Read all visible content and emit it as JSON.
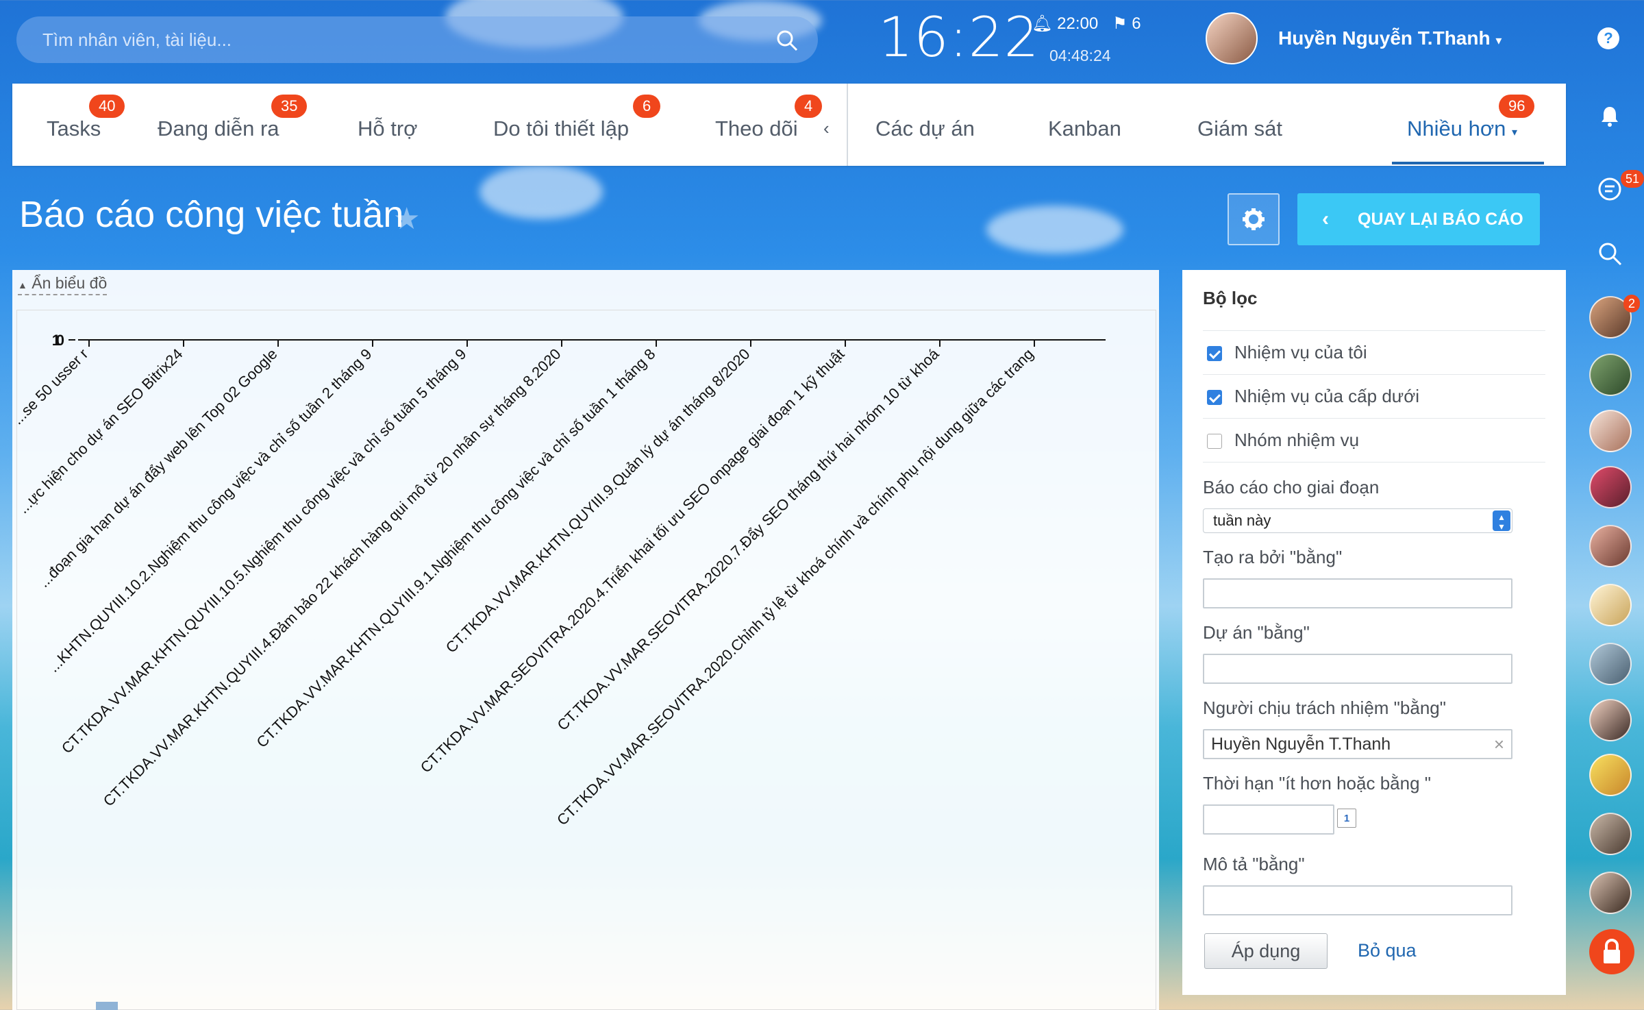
{
  "search": {
    "placeholder": "Tìm nhân viên, tài liệu..."
  },
  "header": {
    "clock": "16:22",
    "alarm": "22:00",
    "flag_count": "6",
    "timer": "04:48:24",
    "user_name": "Huyền Nguyễn T.Thanh",
    "help": "?"
  },
  "tabs": [
    {
      "label": "Tasks",
      "badge": "40"
    },
    {
      "label": "Đang diễn ra",
      "badge": "35"
    },
    {
      "label": "Hỗ trợ",
      "badge": ""
    },
    {
      "label": "Do tôi thiết lập",
      "badge": "6"
    },
    {
      "label": "Theo dõi",
      "badge": "4"
    },
    {
      "label": "Các dự án",
      "badge": ""
    },
    {
      "label": "Kanban",
      "badge": ""
    },
    {
      "label": "Giám sát",
      "badge": ""
    },
    {
      "label": "Nhiều hơn",
      "badge": "96"
    }
  ],
  "page": {
    "title": "Báo cáo công việc tuần",
    "back_button": "QUAY LẠI BÁO CÁO",
    "hide_chart": "Ẩn biểu đồ"
  },
  "chart_data": {
    "type": "bar",
    "ytick_labels": [
      "1",
      "0"
    ],
    "categories": [
      "...se 50 usser r",
      "...ực hiện cho dự án SEO Bitrix24",
      "...đoạn gia hạn dự án đẩy web lên Top 02 Google",
      "...KHTN.QUYIII.10.2.Nghiệm thu công việc và chỉ số tuần 2 tháng 9",
      "CT.TKDA.VV.MAR.KHTN.QUYIII.10.5.Nghiệm thu công việc và chỉ số tuần 5 tháng 9",
      "CT.TKDA.VV.MAR.KHTN.QUYIII.4.Đảm bảo 22 khách hàng qui mô  từ 20 nhân sự tháng 8.2020",
      "CT.TKDA.VV.MAR.KHTN.QUYIII.9.1.Nghiệm thu công việc và chỉ số tuần 1 tháng 8",
      "CT.TKDA.VV.MAR.KHTN.QUYIII.9.Quản lý dự án tháng 8/2020",
      "CT.TKDA.VV.MAR.SEOVITRA.2020.4.Triển khai tối ưu SEO onpage giai đoạn 1 kỹ thuật",
      "CT.TKDA.VV.MAR.SEOVITRA.2020.7.Đẩy SEO tháng thứ hai nhóm 10 từ khoá",
      "CT.TKDA.VV.MAR.SEOVITRA.2020.Chỉnh tỷ lệ từ khoá chính và chính phụ nội dung giữa các trang"
    ],
    "values": [
      0,
      0,
      0,
      0,
      0,
      0,
      0,
      0,
      0,
      0,
      0
    ],
    "legend_color": "#8fb3d6"
  },
  "filter": {
    "title": "Bộ lọc",
    "checks": [
      {
        "label": "Nhiệm vụ của tôi",
        "checked": true
      },
      {
        "label": "Nhiệm vụ của cấp dưới",
        "checked": true
      },
      {
        "label": "Nhóm nhiệm vụ",
        "checked": false
      }
    ],
    "period_label": "Báo cáo cho giai đoạn",
    "period_value": "tuần này",
    "created_by_label": "Tạo ra bởi \"bằng\"",
    "project_label": "Dự án \"bằng\"",
    "responsible_label": "Người chịu trách nhiệm \"bằng\"",
    "responsible_value": "Huyền Nguyễn T.Thanh",
    "deadline_label": "Thời hạn \"ít hơn hoặc bằng \"",
    "description_label": "Mô tả \"bằng\"",
    "apply": "Áp dụng",
    "skip": "Bỏ qua"
  },
  "rail": {
    "chat_badge": "51",
    "avatar_badge": "2"
  },
  "colors": {
    "accent": "#2067b0",
    "badge": "#f0461c",
    "button": "#3bc8f5"
  }
}
